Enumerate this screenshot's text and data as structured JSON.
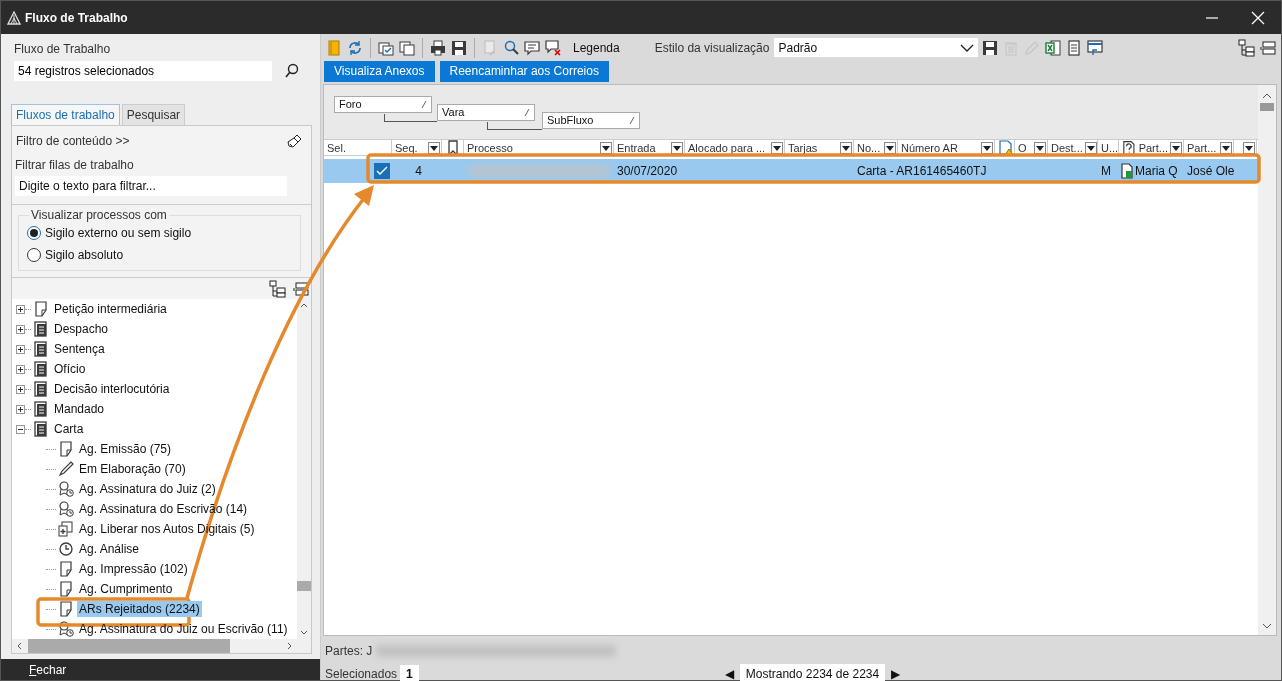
{
  "window": {
    "title": "Fluxo de Trabalho"
  },
  "left": {
    "workflow_label": "Fluxo de Trabalho",
    "workflow_value": "54 registros selecionados",
    "tabs": [
      {
        "label": "Fluxos de trabalho",
        "selected": true
      },
      {
        "label": "Pesquisar",
        "selected": false
      }
    ],
    "content_filter": "Filtro de conteúdo >>",
    "filter_label": "Filtrar filas de trabalho",
    "filter_placeholder": "Digite o texto para filtrar...",
    "visibility": {
      "legend": "Visualizar processos com",
      "options": [
        {
          "label": "Sigilo externo ou sem sigilo",
          "selected": true
        },
        {
          "label": "Sigilo absoluto",
          "selected": false
        }
      ]
    },
    "tree": [
      {
        "label": "Petição intermediária",
        "kind": "page",
        "expanded": false,
        "selected": false
      },
      {
        "label": "Despacho",
        "kind": "stack",
        "expanded": false,
        "selected": false
      },
      {
        "label": "Sentença",
        "kind": "stack",
        "expanded": false,
        "selected": false
      },
      {
        "label": "Ofício",
        "kind": "stack",
        "expanded": false,
        "selected": false
      },
      {
        "label": "Decisão interlocutória",
        "kind": "stack",
        "expanded": false,
        "selected": false
      },
      {
        "label": "Mandado",
        "kind": "stack",
        "expanded": false,
        "selected": false
      },
      {
        "label": "Carta",
        "kind": "stack",
        "expanded": true,
        "selected": false,
        "children": [
          {
            "label": "Ag. Emissão (75)",
            "kind": "page",
            "selected": false
          },
          {
            "label": "Em Elaboração (70)",
            "kind": "pen",
            "selected": false
          },
          {
            "label": "Ag. Assinatura do Juiz (2)",
            "kind": "seal",
            "selected": false
          },
          {
            "label": "Ag. Assinatura do Escrivão (14)",
            "kind": "seal",
            "selected": false
          },
          {
            "label": "Ag. Liberar nos Autos Digitais (5)",
            "kind": "import",
            "selected": false
          },
          {
            "label": "Ag. Análise",
            "kind": "clock",
            "selected": false
          },
          {
            "label": "Ag. Impressão (102)",
            "kind": "page",
            "selected": false
          },
          {
            "label": "Ag. Cumprimento",
            "kind": "page",
            "selected": false
          },
          {
            "label": "ARs Rejeitados (2234)",
            "kind": "page",
            "selected": true
          },
          {
            "label": "Ag. Assinatura do Juiz ou Escrivão (11)",
            "kind": "seal",
            "selected": false
          }
        ]
      }
    ],
    "close_button": "Fechar"
  },
  "toolbar": {
    "icons": [
      {
        "kind": "folder",
        "disabled": false
      },
      {
        "kind": "refresh",
        "disabled": false
      },
      {
        "kind": "sep"
      },
      {
        "kind": "check-copy",
        "disabled": false
      },
      {
        "kind": "copy",
        "disabled": false
      },
      {
        "kind": "sep"
      },
      {
        "kind": "print",
        "disabled": false
      },
      {
        "kind": "save",
        "disabled": false
      },
      {
        "kind": "sep"
      },
      {
        "kind": "export",
        "disabled": true
      },
      {
        "kind": "search-person",
        "disabled": false
      },
      {
        "kind": "comment",
        "disabled": false
      },
      {
        "kind": "comment-x",
        "disabled": false
      }
    ],
    "legend_label": "Legenda",
    "view_style_label": "Estilo da visualização",
    "view_style_value": "Padrão",
    "right_icons": [
      {
        "kind": "save",
        "disabled": false
      },
      {
        "kind": "trash",
        "disabled": true
      },
      {
        "kind": "pencil",
        "disabled": true
      },
      {
        "kind": "excel",
        "disabled": false
      },
      {
        "kind": "doc",
        "disabled": false
      },
      {
        "kind": "window",
        "disabled": false
      }
    ]
  },
  "action_buttons": [
    "Visualiza Anexos",
    "Reencaminhar aos Correios"
  ],
  "grouping": [
    "Foro",
    "Vara",
    "SubFluxo"
  ],
  "table": {
    "columns": [
      {
        "kind": "text",
        "label": "Sel.",
        "filter": false
      },
      {
        "kind": "text",
        "label": "Seq.",
        "filter": true
      },
      {
        "kind": "bookmark",
        "filter": false
      },
      {
        "kind": "text",
        "label": "Processo",
        "filter": true
      },
      {
        "kind": "text",
        "label": "Entrada",
        "filter": true
      },
      {
        "kind": "text",
        "label": "Alocado para ...",
        "filter": true
      },
      {
        "kind": "text",
        "label": "Tarjas",
        "filter": true
      },
      {
        "kind": "text",
        "label": "No...",
        "filter": true
      },
      {
        "kind": "text",
        "label": "Número AR",
        "filter": true
      },
      {
        "kind": "warning",
        "filter": false
      },
      {
        "kind": "text",
        "label": "O",
        "filter": true
      },
      {
        "kind": "text",
        "label": "Dest...",
        "filter": true
      },
      {
        "kind": "text",
        "label": "U...",
        "filter": false
      },
      {
        "kind": "icon-text",
        "label": "Part...",
        "filter": true
      },
      {
        "kind": "text",
        "label": "Part...",
        "filter": true
      },
      {
        "kind": "text",
        "filter": true
      }
    ],
    "rows": [
      {
        "selected": true,
        "checked": true,
        "seq": "4",
        "entrada": "30/07/2020",
        "no": "Carta - AR161465460TJ",
        "u": "M",
        "part_1": "Maria Q",
        "part_2": "José Ole"
      }
    ]
  },
  "footer": {
    "parties_label": "Partes: J",
    "selected_label": "Selecionados",
    "selected_count": "1",
    "prev": "◀",
    "showing": "Mostrando 2234 de 2234",
    "next": "▶"
  }
}
